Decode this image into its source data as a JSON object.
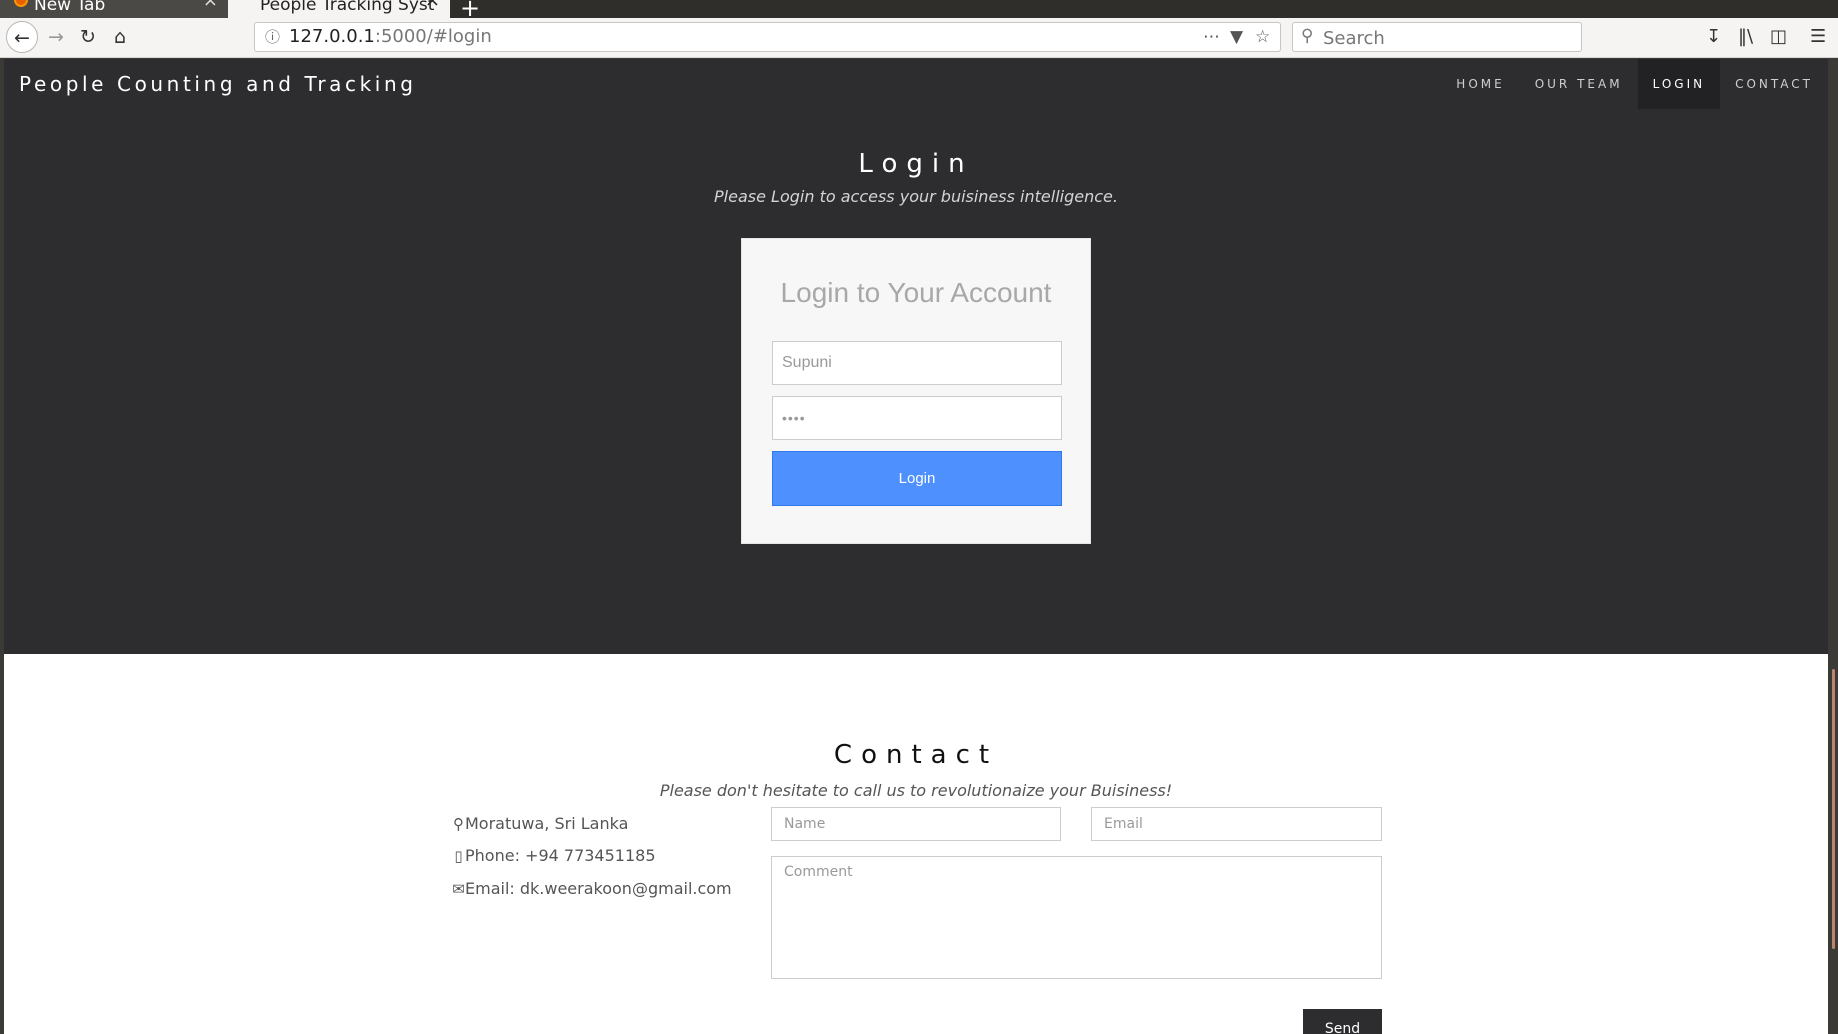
{
  "browser": {
    "tabs": [
      {
        "title": "New Tab"
      },
      {
        "title": "People Tracking Syst"
      }
    ],
    "new_tab_icon": "+",
    "url": {
      "host": "127.0.0.1",
      "rest": ":5000/#login"
    },
    "search_placeholder": "Search",
    "icons": [
      "back-icon",
      "forward-icon",
      "reload-icon",
      "home-icon",
      "info-icon",
      "more-icon",
      "pocket-icon",
      "bookmark-star-icon",
      "search-icon",
      "download-icon",
      "library-icon",
      "sidebar-icon",
      "menu-icon"
    ]
  },
  "header": {
    "brand": "People Counting and Tracking",
    "menu": [
      "HOME",
      "OUR TEAM",
      "LOGIN",
      "CONTACT"
    ],
    "active_item": "LOGIN"
  },
  "login": {
    "title": "Login",
    "subtitle": "Please Login to access your buisiness intelligence.",
    "card_title": "Login to Your Account",
    "username_value": "Supuni",
    "password_value": "••••",
    "button_label": "Login",
    "button_color": "#4d90fe"
  },
  "contact": {
    "title": "Contact",
    "subtitle": "Please don't hesitate to call us to revolutionaize your Buisiness!",
    "address": "Moratuwa, Sri Lanka",
    "phone": "Phone: +94 773451185",
    "email": "Email: dk.weerakoon@gmail.com",
    "name_placeholder": "Name",
    "email_placeholder": "Email",
    "comment_placeholder": "Comment",
    "send_label": "Send"
  },
  "colors": {
    "dark_bg": "#2d2d30",
    "accent": "#4d90fe"
  }
}
